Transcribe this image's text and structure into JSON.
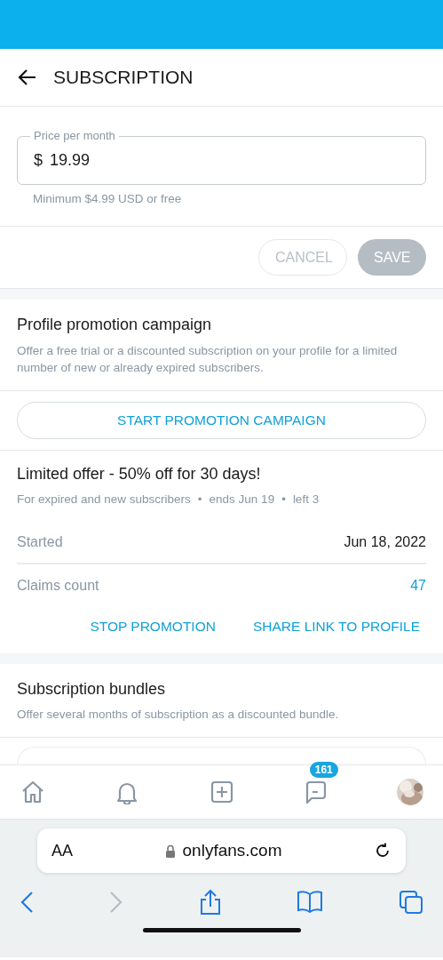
{
  "header": {
    "title": "SUBSCRIPTION"
  },
  "price": {
    "label": "Price per month",
    "currency": "$",
    "value": "19.99",
    "hint": "Minimum $4.99 USD or free"
  },
  "actions": [
    {
      "label": "CANCEL",
      "kind": "outline",
      "disabled": true
    },
    {
      "label": "SAVE",
      "kind": "filled",
      "disabled": true
    }
  ],
  "promotion": {
    "title": "Profile promotion campaign",
    "description": "Offer a free trial or a discounted subscription on your profile for a limited number of new or already expired subscribers.",
    "button": "START PROMOTION CAMPAIGN"
  },
  "offer": {
    "title": "Limited offer - 50% off for 30 days!",
    "meta": [
      "For expired and new subscribers",
      "ends Jun 19",
      "left 3"
    ],
    "meta_separator": "•",
    "rows": [
      {
        "label": "Started",
        "value": "Jun 18, 2022",
        "kind": "plain"
      },
      {
        "label": "Claims count",
        "value": "47",
        "kind": "link"
      }
    ],
    "links": [
      "STOP PROMOTION",
      "SHARE LINK TO PROFILE"
    ]
  },
  "bundles": {
    "title": "Subscription bundles",
    "description": "Offer several months of subscription as a discounted bundle."
  },
  "nav": {
    "items": [
      {
        "kind": "home"
      },
      {
        "kind": "bell"
      },
      {
        "kind": "add"
      },
      {
        "kind": "chat",
        "badge": "161"
      },
      {
        "kind": "avatar"
      }
    ]
  },
  "browser": {
    "text_size": "AA",
    "url": "onlyfans.com"
  }
}
